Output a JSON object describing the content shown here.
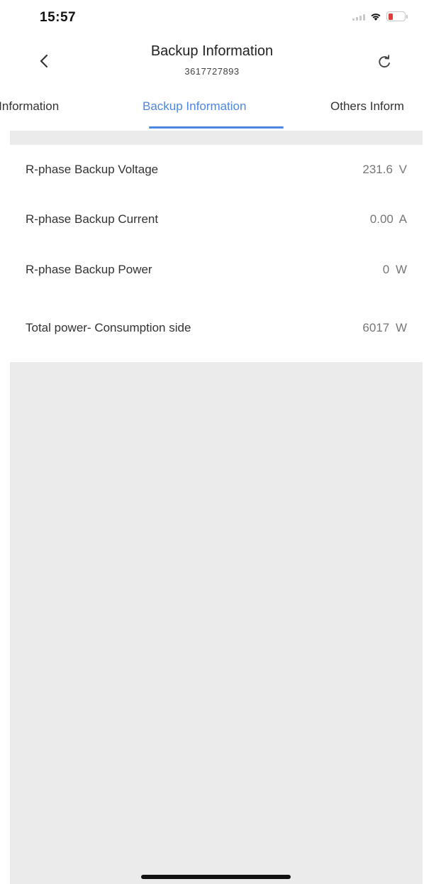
{
  "status_bar": {
    "time": "15:57",
    "icons": [
      "signal-icon",
      "wifi-icon",
      "battery-icon"
    ],
    "battery_color": "#e23b3b"
  },
  "nav": {
    "title": "Backup Information",
    "subtitle": "3617727893",
    "back_icon": "chevron-left-icon",
    "refresh_icon": "refresh-icon"
  },
  "tabs": [
    {
      "label": "d Information",
      "active": false
    },
    {
      "label": "Backup Information",
      "active": true
    },
    {
      "label": "Others Inform",
      "active": false
    }
  ],
  "accent_color": "#4f86e6",
  "rows": [
    {
      "label": "R-phase Backup Voltage",
      "value": "231.6  V"
    },
    {
      "label": "R-phase Backup Current",
      "value": "0.00  A"
    },
    {
      "label": "R-phase Backup Power",
      "value": "0  W"
    },
    {
      "label": "Total power- Consumption side",
      "value": "6017  W"
    }
  ]
}
